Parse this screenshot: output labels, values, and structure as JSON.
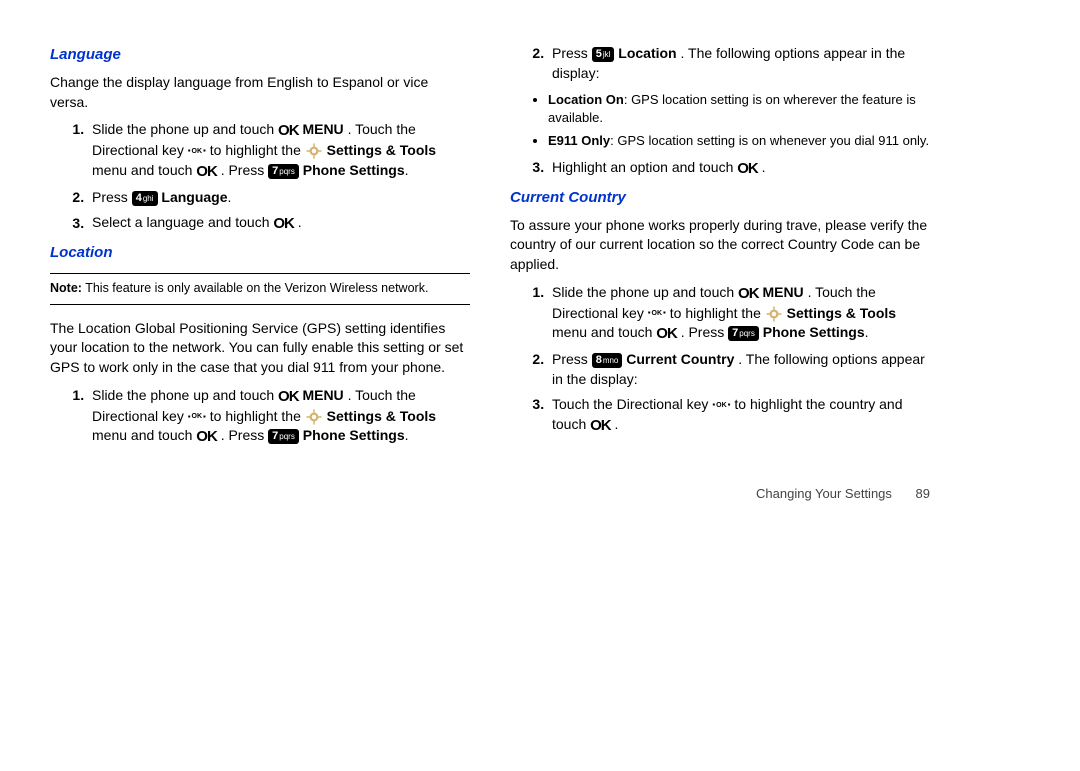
{
  "left": {
    "language": {
      "heading": "Language",
      "intro": "Change the display language from English to Espanol or vice versa.",
      "step1_a": "Slide the phone up and touch ",
      "step1_menu": "MENU",
      "step1_b": ". Touch the Directional key ",
      "step1_c": " to highlight the ",
      "step1_settings": "Settings & Tools",
      "step1_d": " menu and touch ",
      "step1_press": ". Press ",
      "step1_phone": "Phone Settings",
      "step1_end": ".",
      "step2_a": "Press ",
      "step2_lang": "Language",
      "step2_end": ".",
      "step3_a": "Select a language and touch ",
      "step3_end": "."
    },
    "location": {
      "heading": "Location",
      "note_label": "Note:",
      "note_text": " This feature is only available on the Verizon Wireless network.",
      "intro": "The Location Global Positioning Service (GPS) setting identifies your location to the network. You can fully enable this setting or set GPS to work only in the case that you dial 911 from your phone.",
      "step1_a": "Slide the phone up and touch ",
      "step1_menu": "MENU",
      "step1_b": ". Touch the Directional key ",
      "step1_c": " to highlight the ",
      "step1_settings": "Settings & Tools",
      "step1_d": " menu and touch ",
      "step1_press": ". Press ",
      "step1_phone": "Phone Settings",
      "step1_end": "."
    }
  },
  "right": {
    "location": {
      "step2_a": "Press ",
      "step2_loc": "Location",
      "step2_b": ". The following options appear in the display:",
      "opt1_label": "Location On",
      "opt1_text": ": GPS location setting is on wherever the feature is available.",
      "opt2_label": "E911 Only",
      "opt2_text": ": GPS location setting is on whenever you dial 911 only.",
      "step3_a": "Highlight an option and touch ",
      "step3_end": "."
    },
    "country": {
      "heading": "Current Country",
      "intro": "To assure your phone works properly during trave, please verify the country of our current location so the correct Country Code can be applied.",
      "step1_a": "Slide the phone up and touch ",
      "step1_menu": "MENU",
      "step1_b": ". Touch the Directional key ",
      "step1_c": " to highlight the ",
      "step1_settings": "Settings & Tools",
      "step1_d": " menu and touch ",
      "step1_press": ". Press ",
      "step1_phone": "Phone Settings",
      "step1_end": ".",
      "step2_a": "Press ",
      "step2_cc": "Current Country",
      "step2_b": ". The following options appear in the display:",
      "step3_a": "Touch the Directional key ",
      "step3_b": " to highlight the country and touch ",
      "step3_end": "."
    }
  },
  "keys": {
    "k4": "4",
    "k4s": "ghi",
    "k5": "5",
    "k5s": "jkl",
    "k7": "7",
    "k7s": "pqrs",
    "k8": "8",
    "k8s": "mno"
  },
  "footer": {
    "section": "Changing Your Settings",
    "page": "89"
  },
  "icons": {
    "ok": "OK",
    "menu": "MENU"
  }
}
